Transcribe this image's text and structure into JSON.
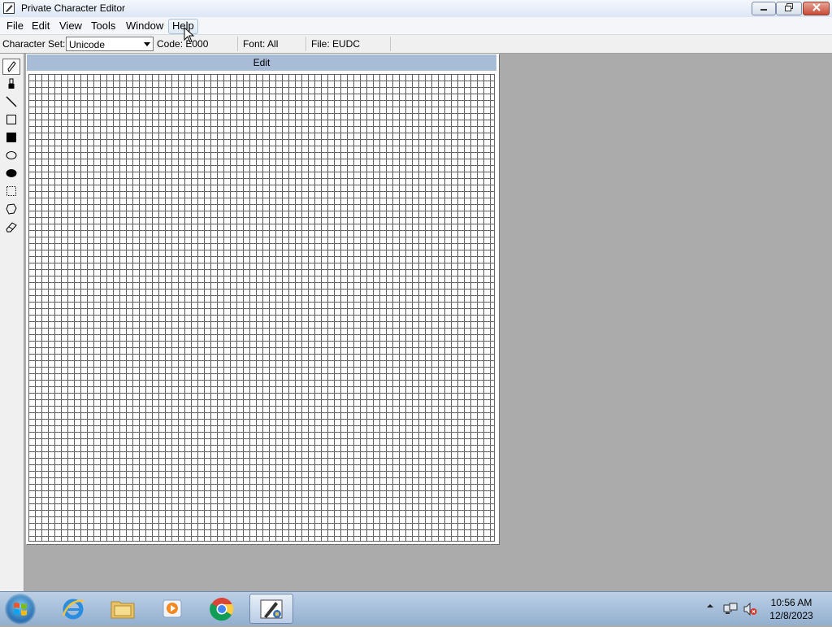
{
  "window": {
    "title": "Private Character Editor"
  },
  "menu": [
    "File",
    "Edit",
    "View",
    "Tools",
    "Window",
    "Help"
  ],
  "infobar": {
    "charset_label": "Character Set:",
    "charset_value": "Unicode",
    "code": "Code: E000",
    "font": "Font: All",
    "file": "File: EUDC"
  },
  "tools": [
    "pencil-icon",
    "brush-icon",
    "line-icon",
    "hollow-rectangle-icon",
    "filled-rectangle-icon",
    "hollow-ellipse-icon",
    "filled-ellipse-icon",
    "rectangular-selection-icon",
    "freeform-selection-icon",
    "eraser-icon"
  ],
  "editor": {
    "caption": "Edit"
  },
  "taskbar": {
    "apps": [
      "internet-explorer-icon",
      "file-explorer-icon",
      "media-player-icon",
      "chrome-icon",
      "private-character-editor-icon"
    ],
    "time": "10:56 AM",
    "date": "12/8/2023"
  },
  "colors": {
    "caption_bar": "#a8bcd8",
    "workspace": "#ababab",
    "grid_line": "#5f5f5f"
  }
}
